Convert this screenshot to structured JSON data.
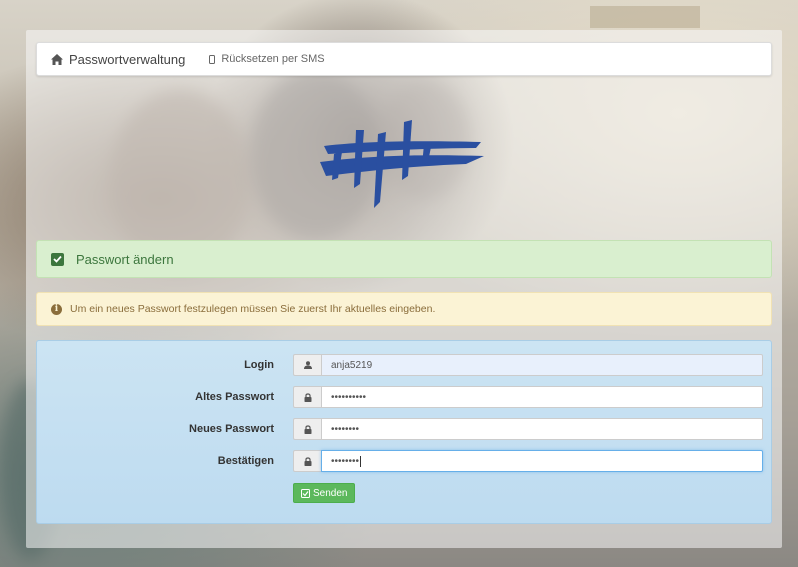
{
  "nav": {
    "brand_icon": "home-icon",
    "brand_label": "Passwortverwaltung",
    "sms_icon": "mobile-icon",
    "sms_label": "Rücksetzen per SMS"
  },
  "logo": {
    "icon": "school-logo-icon",
    "color": "#2a4fa0"
  },
  "success_panel": {
    "icon": "check-square-icon",
    "title": "Passwort ändern"
  },
  "warning": {
    "icon": "info-circle-icon",
    "text": "Um ein neues Passwort festzulegen müssen Sie zuerst Ihr aktuelles eingeben."
  },
  "form": {
    "login": {
      "label": "Login",
      "icon": "user-icon",
      "value": "anja5219"
    },
    "old_password": {
      "label": "Altes Passwort",
      "icon": "lock-icon",
      "value": "••••••••••"
    },
    "new_password": {
      "label": "Neues Passwort",
      "icon": "lock-icon",
      "value": "••••••••"
    },
    "confirm": {
      "label": "Bestätigen",
      "icon": "lock-icon",
      "value": "••••••••"
    },
    "submit_icon": "check-square-icon",
    "submit_label": "Senden"
  },
  "colors": {
    "success_bg": "#d9efcf",
    "warning_bg": "#fbf3d5",
    "form_bg": "#cce4f3",
    "button": "#5cb85c"
  }
}
